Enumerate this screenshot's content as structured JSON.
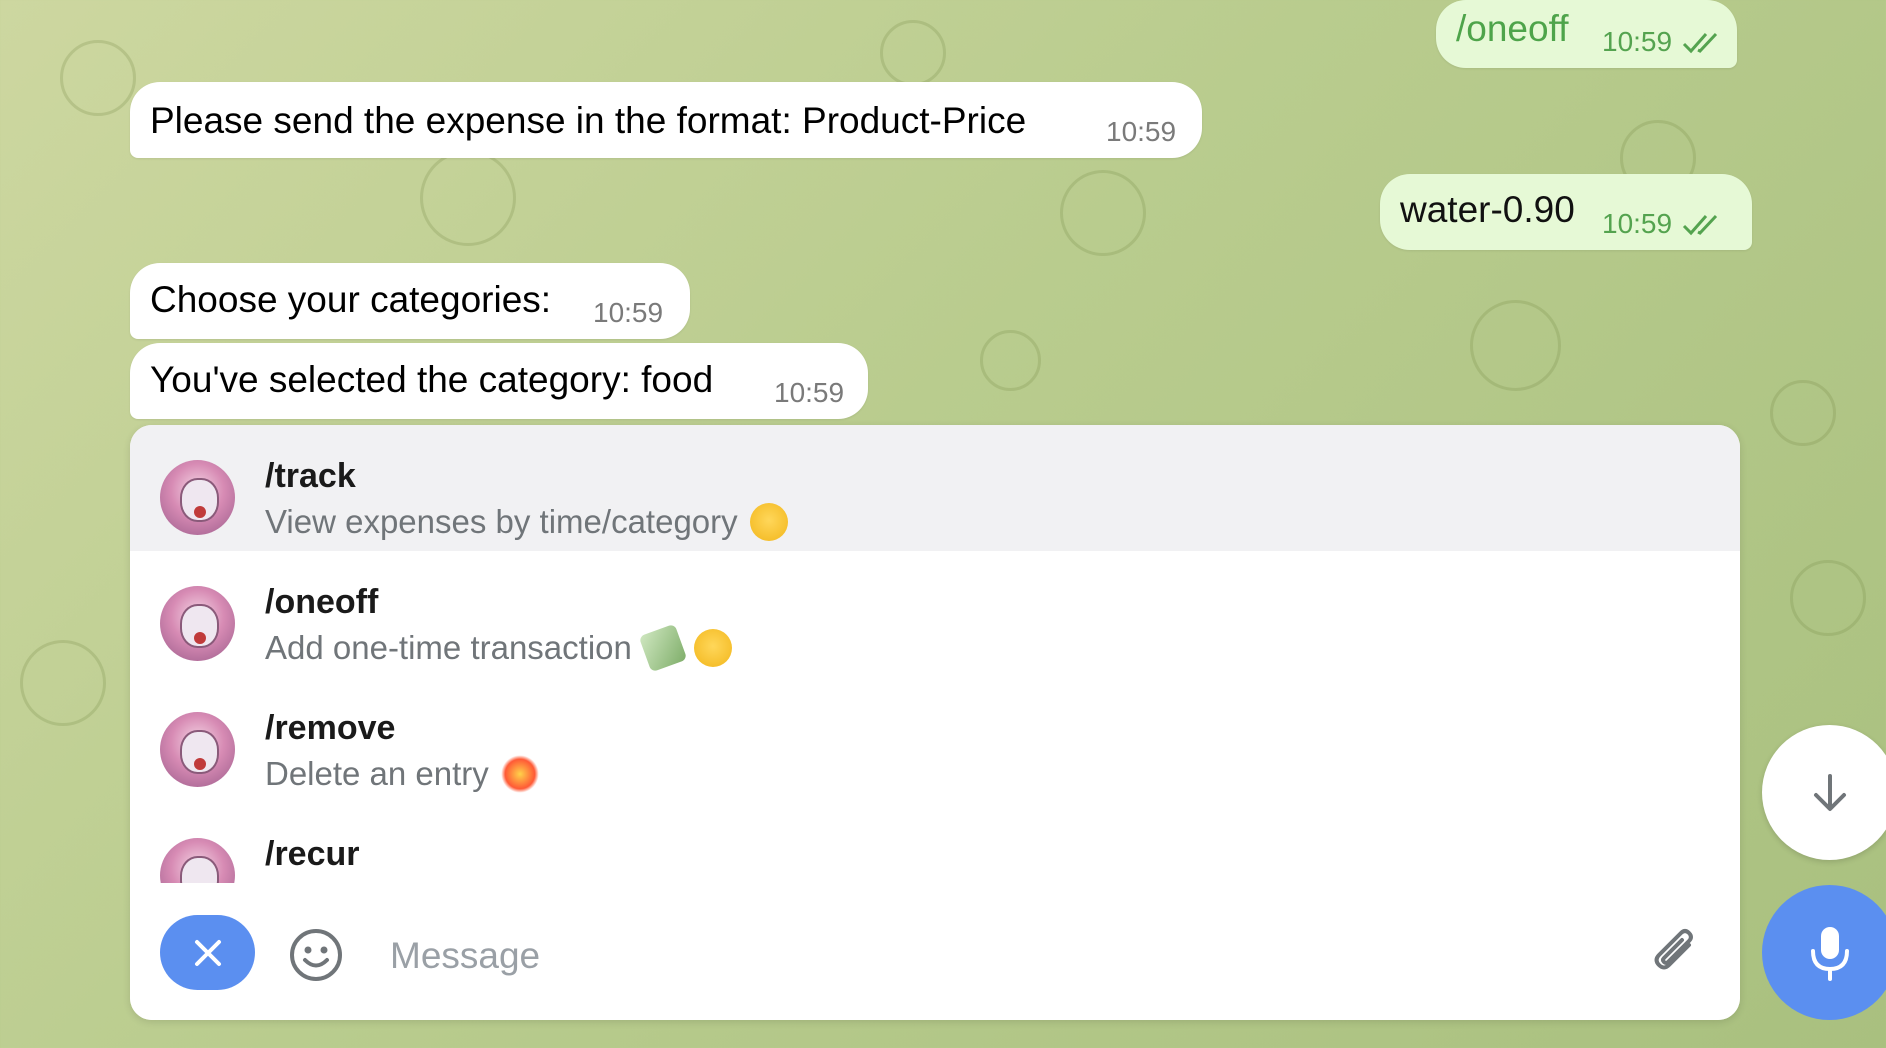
{
  "messages": [
    {
      "direction": "out",
      "text": "/oneoff",
      "time": "10:59",
      "status": "read"
    },
    {
      "direction": "in",
      "text": "Please send the expense in the format: Product-Price",
      "time": "10:59"
    },
    {
      "direction": "out",
      "text": "water-0.90",
      "time": "10:59",
      "status": "read"
    },
    {
      "direction": "in",
      "text": "Choose your categories:",
      "time": "10:59"
    },
    {
      "direction": "in",
      "text": "You've selected the category: food",
      "time": "10:59"
    }
  ],
  "commands": [
    {
      "name": "/track",
      "description": "View expenses by time/category",
      "emojis": [
        "nerd-face-emoji"
      ],
      "active": true
    },
    {
      "name": "/oneoff",
      "description": "Add one-time transaction",
      "emojis": [
        "money-with-wings-emoji",
        "money-mouth-face-emoji"
      ],
      "active": false
    },
    {
      "name": "/remove",
      "description": "Delete an entry",
      "emojis": [
        "collision-emoji"
      ],
      "active": false
    },
    {
      "name": "/recur",
      "description": "",
      "emojis": [],
      "active": false
    }
  ],
  "composer": {
    "placeholder": "Message",
    "close_icon": "close-icon",
    "emoji_icon": "smiley-icon",
    "attach_icon": "paperclip-icon",
    "mic_icon": "microphone-icon"
  },
  "scroll_down_icon": "arrow-down-icon",
  "colors": {
    "accent": "#5b8ff0",
    "outgoing_bubble": "#e6f9d6",
    "outgoing_text_accent": "#4ea44a",
    "incoming_bubble": "#ffffff",
    "active_row": "#f1f1f3"
  }
}
